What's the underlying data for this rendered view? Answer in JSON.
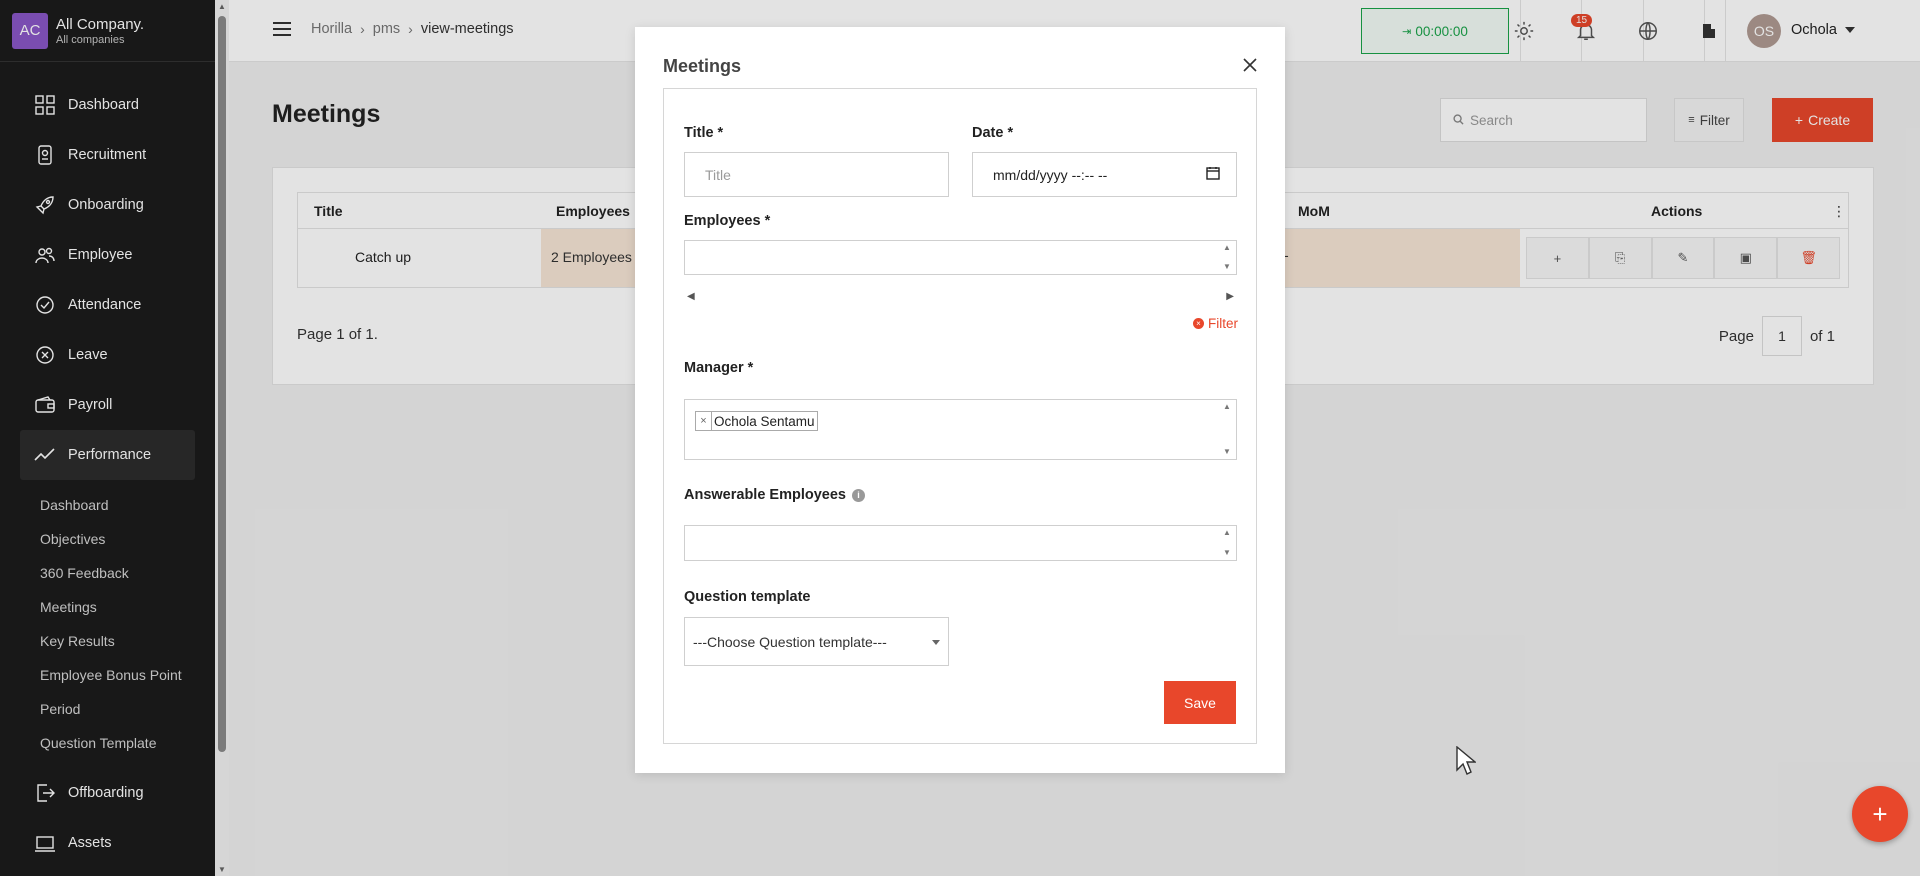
{
  "company": {
    "initials": "AC",
    "name": "All Company.",
    "sub": "All companies"
  },
  "sidebar": {
    "items": [
      {
        "label": "Dashboard",
        "icon": "grid-icon"
      },
      {
        "label": "Recruitment",
        "icon": "badge-icon"
      },
      {
        "label": "Onboarding",
        "icon": "rocket-icon"
      },
      {
        "label": "Employee",
        "icon": "people-icon"
      },
      {
        "label": "Attendance",
        "icon": "check-circle-icon"
      },
      {
        "label": "Leave",
        "icon": "x-circle-icon"
      },
      {
        "label": "Payroll",
        "icon": "wallet-icon"
      },
      {
        "label": "Performance",
        "icon": "trend-icon",
        "active": true
      }
    ],
    "sub_items": [
      "Dashboard",
      "Objectives",
      "360 Feedback",
      "Meetings",
      "Key Results",
      "Employee Bonus Point",
      "Period",
      "Question Template"
    ],
    "items_after": [
      {
        "label": "Offboarding",
        "icon": "exit-icon"
      },
      {
        "label": "Assets",
        "icon": "laptop-icon"
      }
    ]
  },
  "header": {
    "breadcrumb": [
      "Horilla",
      "pms",
      "view-meetings"
    ],
    "timer": "00:00:00",
    "notifications": "15",
    "avatar_initials": "OS",
    "user_name": "Ochola"
  },
  "main": {
    "title": "Meetings",
    "search_placeholder": "Search",
    "filter_label": "Filter",
    "create_label": "Create",
    "table": {
      "headers": [
        "Title",
        "Employees",
        "MoM",
        "Actions"
      ],
      "row": {
        "title": "Catch up",
        "employees": "2 Employees",
        "mom": "-"
      }
    },
    "page_info": "Page 1 of 1.",
    "pager": {
      "label": "Page",
      "current": "1",
      "of": "of 1"
    }
  },
  "modal": {
    "title": "Meetings",
    "title_label": "Title",
    "title_placeholder": "Title",
    "date_label": "Date",
    "date_value": "mm/dd/yyyy --:-- --",
    "employees_label": "Employees",
    "filter_link": "Filter",
    "manager_label": "Manager",
    "manager_selected": "Ochola Sentamu",
    "answerable_label": "Answerable Employees",
    "question_template_label": "Question template",
    "question_template_value": "---Choose Question template---",
    "save_label": "Save",
    "required_mark": "*"
  },
  "colors": {
    "accent": "#e8472b",
    "timer": "#1aa34a",
    "sidebar": "#1c1c1c"
  }
}
